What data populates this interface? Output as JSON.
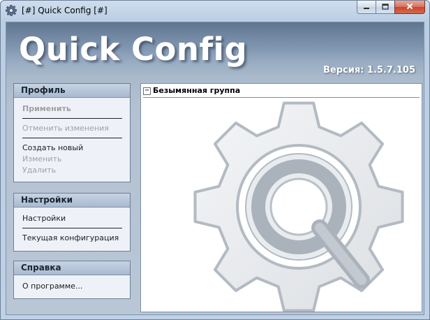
{
  "window": {
    "title": "[#] Quick Config [#]",
    "icon": "gear-icon",
    "controls": {
      "minimize": "minimize-icon",
      "maximize": "maximize-icon",
      "close": "close-icon"
    }
  },
  "banner": {
    "title": "Quick Config",
    "version": "Версия: 1.5.7.105"
  },
  "panels": {
    "profile": {
      "header": "Профиль",
      "apply": "Применить",
      "cancel_changes": "Отменить изменения",
      "create_new": "Создать новый",
      "edit": "Изменить",
      "delete": "Удалить"
    },
    "settings": {
      "header": "Настройки",
      "settings": "Настройки",
      "current_config": "Текущая конфигурация"
    },
    "help": {
      "header": "Справка",
      "about": "О программе..."
    }
  },
  "content": {
    "expander": "−",
    "group_title": "Безымянная группа"
  },
  "colors": {
    "banner_top": "#607590",
    "panel_header": "#a9bad0",
    "disabled_text": "#a0a0a0"
  }
}
